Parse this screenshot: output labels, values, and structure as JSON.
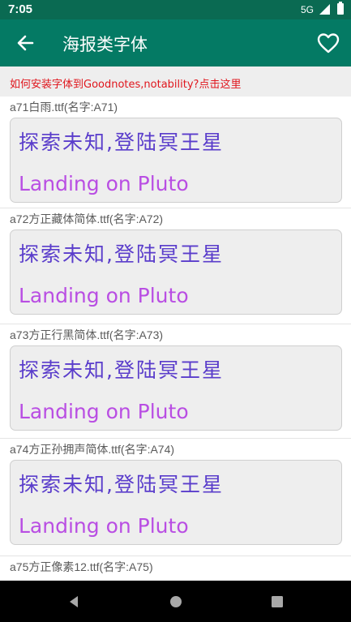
{
  "status_bar": {
    "time": "7:05",
    "network": "5G"
  },
  "app_bar": {
    "title": "海报类字体",
    "back_icon": "back-arrow-icon",
    "favorite_icon": "heart-outline-icon"
  },
  "banner": {
    "text": "如何安装字体到Goodnotes,notability?点击这里"
  },
  "fonts": [
    {
      "name": "a71白雨.ttf(名字:A71)",
      "preview_zh": "探索未知,登陆冥王星",
      "preview_en": "Landing on Pluto"
    },
    {
      "name": "a72方正藏体简体.ttf(名字:A72)",
      "preview_zh": "探索未知,登陆冥王星",
      "preview_en": "Landing on Pluto"
    },
    {
      "name": "a73方正行黑简体.ttf(名字:A73)",
      "preview_zh": "探索未知,登陆冥王星",
      "preview_en": "Landing on Pluto"
    },
    {
      "name": "a74方正孙拥声简体.ttf(名字:A74)",
      "preview_zh": "探索未知,登陆冥王星",
      "preview_en": "Landing on Pluto"
    },
    {
      "name": "a75方正像素12.ttf(名字:A75)"
    }
  ],
  "colors": {
    "app_bar": "#047a64",
    "status_bar": "#0a6a52",
    "banner_text": "#e0161d",
    "preview_zh": "#5a3dcb",
    "preview_en": "#b94ee3"
  }
}
